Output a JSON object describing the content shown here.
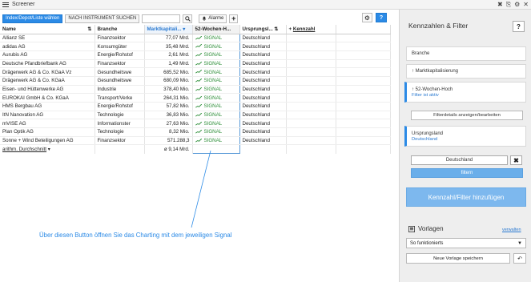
{
  "window": {
    "title": "Screener",
    "controls": [
      "✖",
      "⎘",
      "⚙",
      "✕"
    ]
  },
  "toolbar": {
    "index_button": "Index/Depot/Liste wählen",
    "search_by_instrument": "NACH INSTRUMENT SUCHEN",
    "search_placeholder": "",
    "alarm_label": "Alarme",
    "plus_label": "+",
    "help_label": "?"
  },
  "table": {
    "columns": [
      {
        "label": "Name",
        "sort": "⇅"
      },
      {
        "label": "Branche",
        "sort": ""
      },
      {
        "label": "Marktkapitali...",
        "sort": "▾"
      },
      {
        "label": "52-Wochen-H...",
        "sort": ""
      },
      {
        "label": "Ursprungsl...",
        "sort": "⇅"
      },
      {
        "label": "Kennzahl",
        "sort": ""
      }
    ],
    "add_column_icon": "+",
    "rows": [
      {
        "name": "Allianz SE",
        "branche": "Finanzsektor",
        "cap": "77,07 Mrd.",
        "signal": "SIGNAL",
        "land": "Deutschland"
      },
      {
        "name": "adidas AG",
        "branche": "Konsumgüter",
        "cap": "35,48 Mrd.",
        "signal": "SIGNAL",
        "land": "Deutschland"
      },
      {
        "name": "Aurubis AG",
        "branche": "Energie/Rohstof",
        "cap": "2,61 Mrd.",
        "signal": "SIGNAL",
        "land": "Deutschland"
      },
      {
        "name": "Deutsche Pfandbriefbank AG",
        "branche": "Finanzsektor",
        "cap": "1,49 Mrd.",
        "signal": "SIGNAL",
        "land": "Deutschland"
      },
      {
        "name": "Drägerwerk AG & Co. KGaA Vz",
        "branche": "Gesundheitswe",
        "cap": "685,52 Mio.",
        "signal": "SIGNAL",
        "land": "Deutschland"
      },
      {
        "name": "Drägerwerk AG & Co. KGaA",
        "branche": "Gesundheitswe",
        "cap": "680,09 Mio.",
        "signal": "SIGNAL",
        "land": "Deutschland"
      },
      {
        "name": "Eisen- und Hüttenwerke AG",
        "branche": "Industrie",
        "cap": "378,40 Mio.",
        "signal": "SIGNAL",
        "land": "Deutschland"
      },
      {
        "name": "EUROKAI GmbH & Co. KGaA",
        "branche": "Transport/Verke",
        "cap": "264,31 Mio.",
        "signal": "SIGNAL",
        "land": "Deutschland"
      },
      {
        "name": "HMS Bergbau AG",
        "branche": "Energie/Rohstof",
        "cap": "57,82 Mio.",
        "signal": "SIGNAL",
        "land": "Deutschland"
      },
      {
        "name": "ItN Nanovation AG",
        "branche": "Technologie",
        "cap": "36,83 Mio.",
        "signal": "SIGNAL",
        "land": "Deutschland"
      },
      {
        "name": "mVISE AG",
        "branche": "Informationster",
        "cap": "27,63 Mio.",
        "signal": "SIGNAL",
        "land": "Deutschland"
      },
      {
        "name": "Plan Optik AG",
        "branche": "Technologie",
        "cap": "8,32 Mio.",
        "signal": "SIGNAL",
        "land": "Deutschland"
      },
      {
        "name": "Sonne + Wind Beteiligungen AG",
        "branche": "Finanzsektor",
        "cap": "571.288,3",
        "signal": "SIGNAL",
        "land": "Deutschland"
      }
    ],
    "average": {
      "label": "arithm. Durchschnitt",
      "caret": "▾",
      "value": "ø 9,14 Mrd."
    }
  },
  "annotation": {
    "text": "Über diesen Button öffnen Sie das Charting mit dem jeweiligen Signal",
    "color": "#2b8ae6"
  },
  "right_panel": {
    "title": "Kennzahlen & Filter",
    "help": "?",
    "filters": {
      "branche": "Branche",
      "marktkap": "↑ Marktkapitalisierung",
      "wochenhoch": "↑ 52-Wochen-Hoch",
      "wochenhoch_sub": "Filter ist aktiv",
      "details_button": "Filterdetails anzeigen/bearbeiten",
      "ursprungsland": "Ursprungsland",
      "ursprungsland_sub": "Deutschland",
      "country_value": "Deutschland",
      "clear": "✖",
      "filter_button": "filtern"
    },
    "add_button": "Kennzahl/Filter hinzufügen",
    "vorlagen": {
      "title": "Vorlagen",
      "manage": "verwalten",
      "selected": "So funktionierts",
      "save_button": "Neue Vorlage speichern",
      "back_icon": "↶"
    }
  },
  "colors": {
    "accent": "#2b8ae6",
    "signal": "#2f8f3a",
    "panel_bg": "#eeeeee"
  }
}
